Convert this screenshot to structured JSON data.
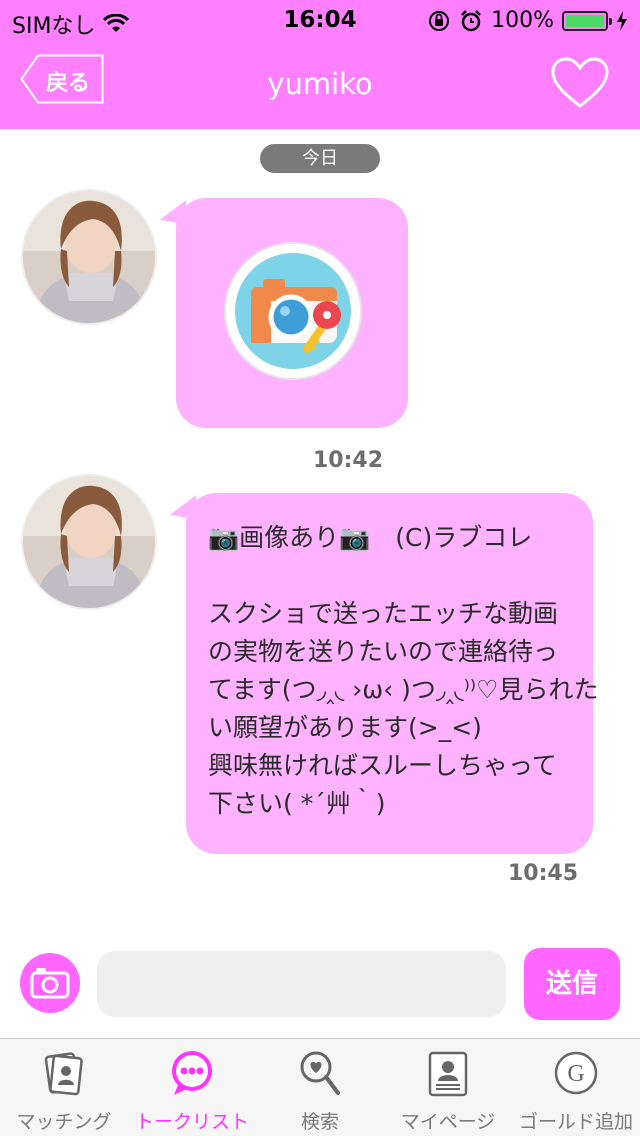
{
  "status_bar": {
    "carrier": "SIMなし",
    "time": "16:04",
    "battery_percent": "100%",
    "battery_level": 1.0
  },
  "nav": {
    "back_label": "戻る",
    "title": "yumiko"
  },
  "chat": {
    "date_label": "今日",
    "messages": [
      {
        "type": "image",
        "icon": "camera-key-icon",
        "time": "10:42"
      },
      {
        "type": "text",
        "lines": [
          "📷画像あり📷　(C)ラブコレ",
          "",
          "スクショで送ったエッチな動画",
          "の実物を送りたいので連絡待っ",
          "てます(つ◞‸◟ ›ω‹ )つ◞‸◟⁾⁾♡見られた",
          "い願望があります(>_<)",
          "興味無ければスルーしちゃって",
          "下さい( *´艸｀)"
        ],
        "time": "10:45"
      }
    ]
  },
  "input": {
    "value": "",
    "placeholder": "",
    "send_label": "送信"
  },
  "tabs": [
    {
      "label": "マッチング",
      "icon": "matching-icon",
      "active": false
    },
    {
      "label": "トークリスト",
      "icon": "talk-list-icon",
      "active": true
    },
    {
      "label": "検索",
      "icon": "search-icon",
      "active": false
    },
    {
      "label": "マイページ",
      "icon": "mypage-icon",
      "active": false
    },
    {
      "label": "ゴールド追加",
      "icon": "gold-icon",
      "active": false
    }
  ],
  "colors": {
    "accent": "#ff80ff",
    "bubble": "#ffb2ff",
    "button": "#ff66ff",
    "active_tab": "#ff33ff"
  }
}
